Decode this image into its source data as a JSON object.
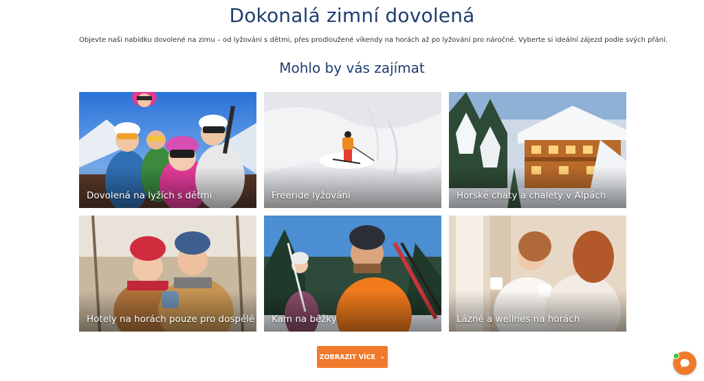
{
  "header": {
    "title": "Dokonalá zimní dovolená",
    "intro": "Objevte naši nabídku dovolené na zimu – od lyžování s dětmi, přes prodloužené víkendy na horách až po lyžování pro náročné. Vyberte si ideální zájezd podle svých přání."
  },
  "section": {
    "title": "Mohlo by vás zajímat"
  },
  "cards": [
    {
      "label": "Dovolená na lyžích s dětmi",
      "icon": "family-ski-photo"
    },
    {
      "label": "Freeride lyžování",
      "icon": "freeride-skier-photo"
    },
    {
      "label": "Horské chaty a chalety v Alpách",
      "icon": "alpine-chalet-photo"
    },
    {
      "label": "Hotely na horách pouze pro dospělé",
      "icon": "winter-couple-photo"
    },
    {
      "label": "Kam na běžky",
      "icon": "cross-country-skiers-photo"
    },
    {
      "label": "Lázně a wellnes na horách",
      "icon": "spa-wellness-photo"
    }
  ],
  "more_button": {
    "label": "ZOBRAZIT VÍCE",
    "icon": "chevron-down-icon"
  },
  "chat": {
    "icon": "chat-bubble-icon"
  },
  "colors": {
    "title": "#1f3d6e",
    "accent": "#f07a2c",
    "online": "#3cc13b"
  }
}
